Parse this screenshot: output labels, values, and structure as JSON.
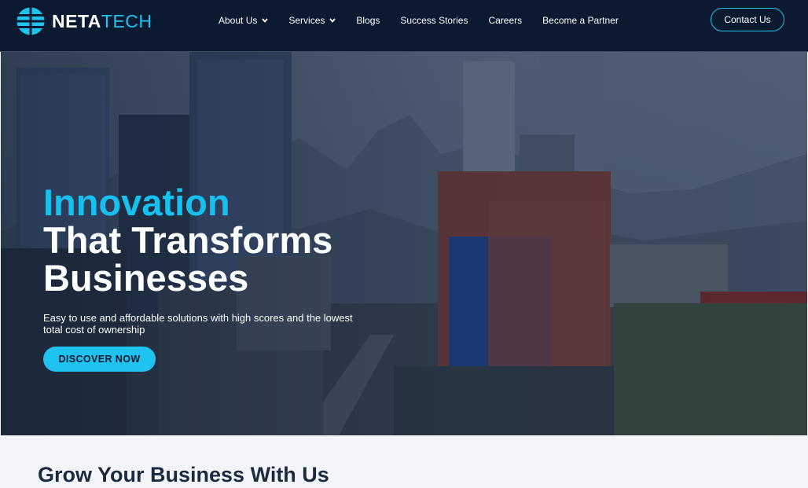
{
  "brand": {
    "name_primary": "NETA",
    "name_accent": "TECH",
    "logo_icon": "globe-stripes-icon",
    "accent_color": "#1ec3f0",
    "nav_bg": "#0b1a30"
  },
  "nav": {
    "items": [
      {
        "label": "About Us",
        "has_dropdown": true
      },
      {
        "label": "Services",
        "has_dropdown": true
      },
      {
        "label": "Blogs",
        "has_dropdown": false
      },
      {
        "label": "Success Stories",
        "has_dropdown": false
      },
      {
        "label": "Careers",
        "has_dropdown": false
      },
      {
        "label": "Become a Partner",
        "has_dropdown": false
      }
    ],
    "contact_label": "Contact Us"
  },
  "hero": {
    "title_accent": "Innovation",
    "title_line2": "That Transforms",
    "title_line3": "Businesses",
    "subtitle": "Easy to use and affordable solutions with high scores and the lowest total cost of ownership",
    "cta_label": "DISCOVER NOW"
  },
  "section": {
    "heading": "Grow Your Business With Us"
  }
}
